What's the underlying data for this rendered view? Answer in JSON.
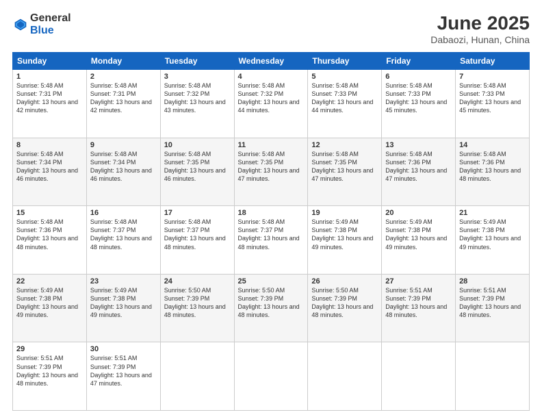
{
  "header": {
    "logo_general": "General",
    "logo_blue": "Blue",
    "title": "June 2025",
    "location": "Dabaozi, Hunan, China"
  },
  "weekdays": [
    "Sunday",
    "Monday",
    "Tuesday",
    "Wednesday",
    "Thursday",
    "Friday",
    "Saturday"
  ],
  "weeks": [
    [
      {
        "day": "1",
        "sunrise": "Sunrise: 5:48 AM",
        "sunset": "Sunset: 7:31 PM",
        "daylight": "Daylight: 13 hours and 42 minutes."
      },
      {
        "day": "2",
        "sunrise": "Sunrise: 5:48 AM",
        "sunset": "Sunset: 7:31 PM",
        "daylight": "Daylight: 13 hours and 42 minutes."
      },
      {
        "day": "3",
        "sunrise": "Sunrise: 5:48 AM",
        "sunset": "Sunset: 7:32 PM",
        "daylight": "Daylight: 13 hours and 43 minutes."
      },
      {
        "day": "4",
        "sunrise": "Sunrise: 5:48 AM",
        "sunset": "Sunset: 7:32 PM",
        "daylight": "Daylight: 13 hours and 44 minutes."
      },
      {
        "day": "5",
        "sunrise": "Sunrise: 5:48 AM",
        "sunset": "Sunset: 7:33 PM",
        "daylight": "Daylight: 13 hours and 44 minutes."
      },
      {
        "day": "6",
        "sunrise": "Sunrise: 5:48 AM",
        "sunset": "Sunset: 7:33 PM",
        "daylight": "Daylight: 13 hours and 45 minutes."
      },
      {
        "day": "7",
        "sunrise": "Sunrise: 5:48 AM",
        "sunset": "Sunset: 7:33 PM",
        "daylight": "Daylight: 13 hours and 45 minutes."
      }
    ],
    [
      {
        "day": "8",
        "sunrise": "Sunrise: 5:48 AM",
        "sunset": "Sunset: 7:34 PM",
        "daylight": "Daylight: 13 hours and 46 minutes."
      },
      {
        "day": "9",
        "sunrise": "Sunrise: 5:48 AM",
        "sunset": "Sunset: 7:34 PM",
        "daylight": "Daylight: 13 hours and 46 minutes."
      },
      {
        "day": "10",
        "sunrise": "Sunrise: 5:48 AM",
        "sunset": "Sunset: 7:35 PM",
        "daylight": "Daylight: 13 hours and 46 minutes."
      },
      {
        "day": "11",
        "sunrise": "Sunrise: 5:48 AM",
        "sunset": "Sunset: 7:35 PM",
        "daylight": "Daylight: 13 hours and 47 minutes."
      },
      {
        "day": "12",
        "sunrise": "Sunrise: 5:48 AM",
        "sunset": "Sunset: 7:35 PM",
        "daylight": "Daylight: 13 hours and 47 minutes."
      },
      {
        "day": "13",
        "sunrise": "Sunrise: 5:48 AM",
        "sunset": "Sunset: 7:36 PM",
        "daylight": "Daylight: 13 hours and 47 minutes."
      },
      {
        "day": "14",
        "sunrise": "Sunrise: 5:48 AM",
        "sunset": "Sunset: 7:36 PM",
        "daylight": "Daylight: 13 hours and 48 minutes."
      }
    ],
    [
      {
        "day": "15",
        "sunrise": "Sunrise: 5:48 AM",
        "sunset": "Sunset: 7:36 PM",
        "daylight": "Daylight: 13 hours and 48 minutes."
      },
      {
        "day": "16",
        "sunrise": "Sunrise: 5:48 AM",
        "sunset": "Sunset: 7:37 PM",
        "daylight": "Daylight: 13 hours and 48 minutes."
      },
      {
        "day": "17",
        "sunrise": "Sunrise: 5:48 AM",
        "sunset": "Sunset: 7:37 PM",
        "daylight": "Daylight: 13 hours and 48 minutes."
      },
      {
        "day": "18",
        "sunrise": "Sunrise: 5:48 AM",
        "sunset": "Sunset: 7:37 PM",
        "daylight": "Daylight: 13 hours and 48 minutes."
      },
      {
        "day": "19",
        "sunrise": "Sunrise: 5:49 AM",
        "sunset": "Sunset: 7:38 PM",
        "daylight": "Daylight: 13 hours and 49 minutes."
      },
      {
        "day": "20",
        "sunrise": "Sunrise: 5:49 AM",
        "sunset": "Sunset: 7:38 PM",
        "daylight": "Daylight: 13 hours and 49 minutes."
      },
      {
        "day": "21",
        "sunrise": "Sunrise: 5:49 AM",
        "sunset": "Sunset: 7:38 PM",
        "daylight": "Daylight: 13 hours and 49 minutes."
      }
    ],
    [
      {
        "day": "22",
        "sunrise": "Sunrise: 5:49 AM",
        "sunset": "Sunset: 7:38 PM",
        "daylight": "Daylight: 13 hours and 49 minutes."
      },
      {
        "day": "23",
        "sunrise": "Sunrise: 5:49 AM",
        "sunset": "Sunset: 7:38 PM",
        "daylight": "Daylight: 13 hours and 49 minutes."
      },
      {
        "day": "24",
        "sunrise": "Sunrise: 5:50 AM",
        "sunset": "Sunset: 7:39 PM",
        "daylight": "Daylight: 13 hours and 48 minutes."
      },
      {
        "day": "25",
        "sunrise": "Sunrise: 5:50 AM",
        "sunset": "Sunset: 7:39 PM",
        "daylight": "Daylight: 13 hours and 48 minutes."
      },
      {
        "day": "26",
        "sunrise": "Sunrise: 5:50 AM",
        "sunset": "Sunset: 7:39 PM",
        "daylight": "Daylight: 13 hours and 48 minutes."
      },
      {
        "day": "27",
        "sunrise": "Sunrise: 5:51 AM",
        "sunset": "Sunset: 7:39 PM",
        "daylight": "Daylight: 13 hours and 48 minutes."
      },
      {
        "day": "28",
        "sunrise": "Sunrise: 5:51 AM",
        "sunset": "Sunset: 7:39 PM",
        "daylight": "Daylight: 13 hours and 48 minutes."
      }
    ],
    [
      {
        "day": "29",
        "sunrise": "Sunrise: 5:51 AM",
        "sunset": "Sunset: 7:39 PM",
        "daylight": "Daylight: 13 hours and 48 minutes."
      },
      {
        "day": "30",
        "sunrise": "Sunrise: 5:51 AM",
        "sunset": "Sunset: 7:39 PM",
        "daylight": "Daylight: 13 hours and 47 minutes."
      },
      null,
      null,
      null,
      null,
      null
    ]
  ]
}
